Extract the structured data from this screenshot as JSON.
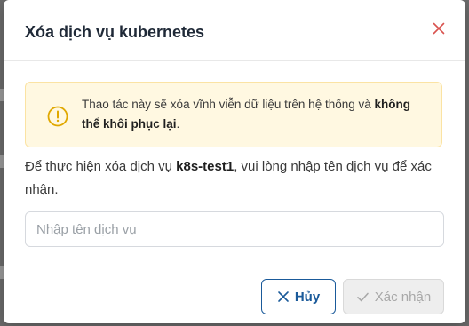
{
  "dialog": {
    "title": "Xóa dịch vụ kubernetes",
    "close_icon": "close-icon"
  },
  "warning": {
    "icon": "exclamation-circle-icon",
    "text_normal": "Thao tác này sẽ xóa vĩnh viễn dữ liệu trên hệ thống và ",
    "text_bold": "không thể khôi phục lại",
    "text_end": ".",
    "colors": {
      "background": "#fff8e1",
      "icon": "#e0a800"
    }
  },
  "description": {
    "prefix": "Để thực hiện xóa dịch vụ ",
    "service_name": "k8s-test1",
    "suffix": ", vui lòng nhập tên dịch vụ để xác nhận."
  },
  "input": {
    "placeholder": "Nhập tên dịch vụ",
    "value": ""
  },
  "footer": {
    "cancel_label": "Hủy",
    "cancel_icon": "x-icon",
    "confirm_label": "Xác nhận",
    "confirm_icon": "check-icon",
    "confirm_disabled": true,
    "colors": {
      "primary": "#1a5a9a",
      "close": "#d9534f"
    }
  }
}
